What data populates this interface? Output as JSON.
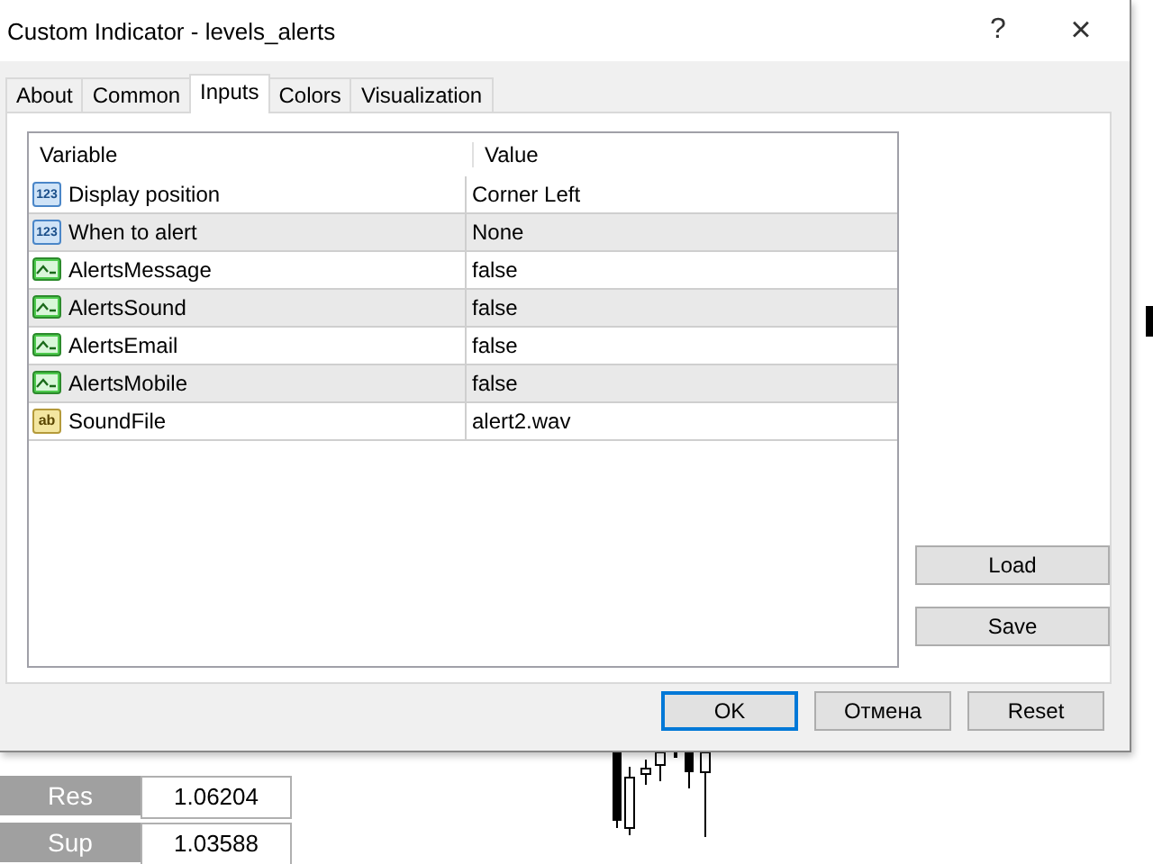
{
  "window": {
    "title": "Custom Indicator - levels_alerts",
    "help": "?",
    "close": "×"
  },
  "tabs": [
    {
      "label": "About",
      "selected": false
    },
    {
      "label": "Common",
      "selected": false
    },
    {
      "label": "Inputs",
      "selected": true
    },
    {
      "label": "Colors",
      "selected": false
    },
    {
      "label": "Visualization",
      "selected": false
    }
  ],
  "table": {
    "columns": [
      "Variable",
      "Value"
    ],
    "rows": [
      {
        "kind": "number",
        "icon_text": "123",
        "variable": "Display position",
        "value": "Corner Left"
      },
      {
        "kind": "number",
        "icon_text": "123",
        "variable": "When to alert",
        "value": "None"
      },
      {
        "kind": "bool",
        "variable": "AlertsMessage",
        "value": "false"
      },
      {
        "kind": "bool",
        "variable": "AlertsSound",
        "value": "false"
      },
      {
        "kind": "bool",
        "variable": "AlertsEmail",
        "value": "false"
      },
      {
        "kind": "bool",
        "variable": "AlertsMobile",
        "value": "false"
      },
      {
        "kind": "string",
        "icon_text": "ab",
        "variable": "SoundFile",
        "value": "alert2.wav"
      }
    ]
  },
  "side_buttons": [
    "Load",
    "Save"
  ],
  "buttons": [
    "OK",
    "Отмена",
    "Reset"
  ],
  "levels_panel": [
    {
      "label": "Res",
      "value": "1.06204"
    },
    {
      "label": "Sup",
      "value": "1.03588"
    }
  ]
}
